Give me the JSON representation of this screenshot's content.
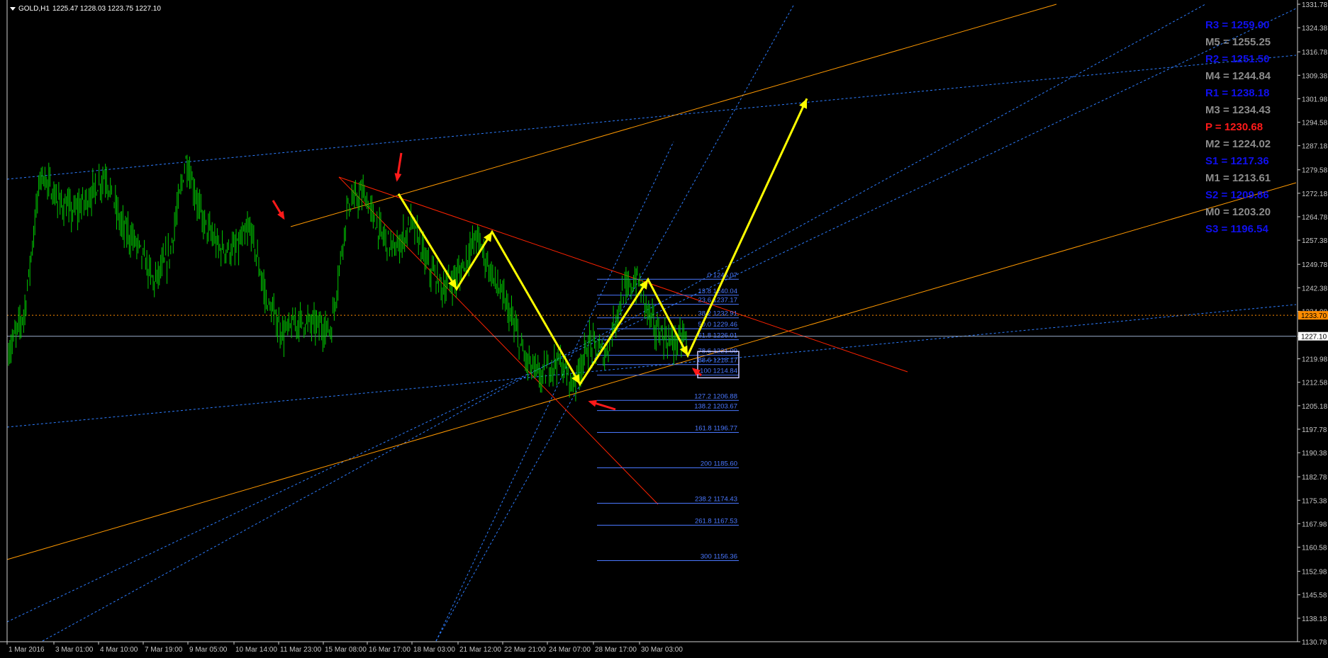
{
  "window": {
    "symbol_title": "GOLD,H1",
    "ohlc": "1225.47 1228.03 1223.75 1227.10"
  },
  "price_axis": {
    "labels": [
      "1331.78",
      "1324.38",
      "1316.78",
      "1309.38",
      "1301.98",
      "1294.58",
      "1287.18",
      "1279.58",
      "1272.18",
      "1264.78",
      "1257.38",
      "1249.78",
      "1242.38",
      "1234.98",
      "1227.10",
      "1219.98",
      "1212.58",
      "1205.18",
      "1197.78",
      "1190.38",
      "1182.78",
      "1175.38",
      "1167.98",
      "1160.58",
      "1152.98",
      "1145.58",
      "1138.18",
      "1130.78"
    ],
    "bid": "1227.10",
    "ask_line": "1233.70"
  },
  "time_axis": {
    "labels": [
      "1 Mar 2016",
      "3 Mar 01:00",
      "4 Mar 10:00",
      "7 Mar 19:00",
      "9 Mar 05:00",
      "10 Mar 14:00",
      "11 Mar 23:00",
      "15 Mar 08:00",
      "16 Mar 17:00",
      "18 Mar 03:00",
      "21 Mar 12:00",
      "22 Mar 21:00",
      "24 Mar 07:00",
      "28 Mar 17:00",
      "30 Mar 03:00"
    ]
  },
  "fibonacci": {
    "levels": [
      {
        "label": "0 1245.07",
        "value": 1245.07
      },
      {
        "label": "13.8 1240.04",
        "value": 1240.04
      },
      {
        "label": "23.6 1237.17",
        "value": 1237.17
      },
      {
        "label": "38.2 1232.91",
        "value": 1232.91
      },
      {
        "label": "50.0 1229.46",
        "value": 1229.46
      },
      {
        "label": "61.8 1226.01",
        "value": 1226.01
      },
      {
        "label": "78.6 1221.09",
        "value": 1221.09
      },
      {
        "label": "88.6 1218.17",
        "value": 1218.17
      },
      {
        "label": "100 1214.84",
        "value": 1214.84
      },
      {
        "label": "127.2 1206.88",
        "value": 1206.88
      },
      {
        "label": "138.2 1203.67",
        "value": 1203.67
      },
      {
        "label": "161.8 1196.77",
        "value": 1196.77
      },
      {
        "label": "200 1185.60",
        "value": 1185.6
      },
      {
        "label": "238.2 1174.43",
        "value": 1174.43
      },
      {
        "label": "261.8 1167.53",
        "value": 1167.53
      },
      {
        "label": "300 1156.36",
        "value": 1156.36
      }
    ]
  },
  "pivots": [
    {
      "text": "R3 = 1259.00",
      "color": "#1010ee"
    },
    {
      "text": "M5 = 1255.25",
      "color": "#8c8c8c"
    },
    {
      "text": "R2 = 1251.50",
      "color": "#1010ee"
    },
    {
      "text": "M4 = 1244.84",
      "color": "#8c8c8c"
    },
    {
      "text": "R1 = 1238.18",
      "color": "#1010ee"
    },
    {
      "text": "M3 = 1234.43",
      "color": "#8c8c8c"
    },
    {
      "text": "P  = 1230.68",
      "color": "#ff1a1a"
    },
    {
      "text": "M2 = 1224.02",
      "color": "#8c8c8c"
    },
    {
      "text": "S1 = 1217.36",
      "color": "#1010ee"
    },
    {
      "text": "M1 = 1213.61",
      "color": "#8c8c8c"
    },
    {
      "text": "S2 = 1209.86",
      "color": "#1010ee"
    },
    {
      "text": "M0 = 1203.20",
      "color": "#8c8c8c"
    },
    {
      "text": "S3 = 1196.54",
      "color": "#1010ee"
    }
  ],
  "colors": {
    "candles": "#00c800",
    "zigzag": "#ffff00",
    "channel_orange": "#ff9900",
    "channel_red": "#ff2200",
    "trend_blue": "#2d7dff",
    "bid_line": "#9aaecc",
    "ask_line": "#ff8c00",
    "arrows": "#ff1a1a",
    "fib": "#4a78ff"
  },
  "chart_data": {
    "type": "line",
    "title": "GOLD,H1",
    "ylim": [
      1130.78,
      1331.78
    ],
    "x_categories": [
      "1 Mar 2016",
      "3 Mar 01:00",
      "4 Mar 10:00",
      "7 Mar 19:00",
      "9 Mar 05:00",
      "10 Mar 14:00",
      "11 Mar 23:00",
      "15 Mar 08:00",
      "16 Mar 17:00",
      "18 Mar 03:00",
      "21 Mar 12:00",
      "22 Mar 21:00",
      "24 Mar 07:00",
      "28 Mar 17:00",
      "30 Mar 03:00"
    ],
    "series": [
      {
        "values": [
          1222,
          1235,
          1279,
          1270,
          1266,
          1271,
          1278,
          1262,
          1256,
          1244,
          1253,
          1283,
          1264,
          1255,
          1254,
          1261,
          1238,
          1228,
          1232,
          1231,
          1229,
          1268,
          1272,
          1260,
          1254,
          1263,
          1249,
          1242,
          1247,
          1259,
          1246,
          1235,
          1220,
          1214,
          1220,
          1212,
          1225,
          1221,
          1240,
          1245,
          1230,
          1225,
          1227
        ]
      }
    ],
    "zigzag_points": [
      1272,
      1242,
      1260,
      1212,
      1245,
      1221,
      1302
    ],
    "grid": false
  }
}
